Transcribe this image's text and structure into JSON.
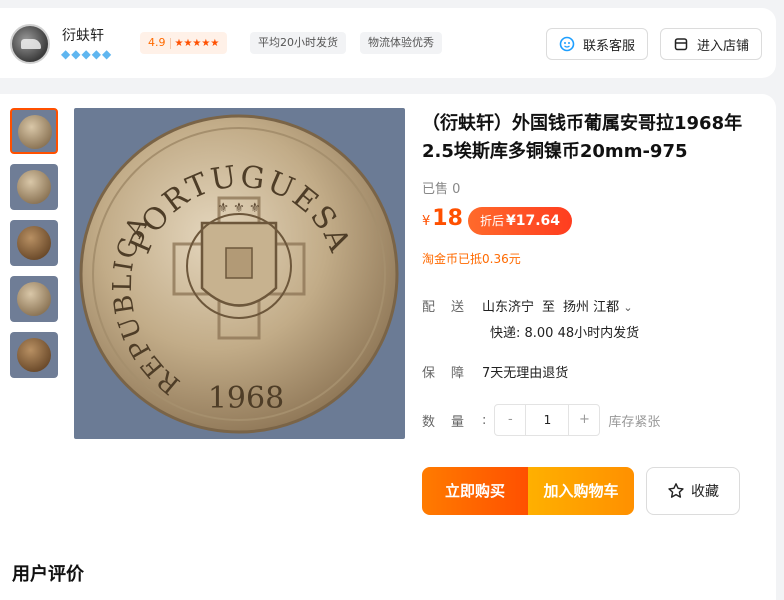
{
  "shop": {
    "name": "衍蚨轩",
    "rating": "4.9",
    "rating_stars": "★★★★★",
    "tags": [
      "平均20小时发货",
      "物流体验优秀"
    ],
    "service_button": "联系客服",
    "store_button": "进入店铺",
    "diamonds": [
      "💎",
      "💎",
      "💎",
      "💎",
      "💎"
    ]
  },
  "product": {
    "title": "（衍蚨轩）外国钱币葡属安哥拉1968年2.5埃斯库多铜镍币20mm-975",
    "sold": "已售 0",
    "price_currency": "¥",
    "price": "18",
    "coupon_label": "折后",
    "coupon_price": "¥17.64",
    "taojin": "淘金币已抵0.36元",
    "coin_text_top": "PORTUGUESA",
    "coin_text_left": "REPUBLICA",
    "coin_year": "1968"
  },
  "delivery": {
    "label": "配送",
    "from": "山东济宁",
    "to_word": "至",
    "to": "扬州 江都",
    "shipping": "快递: 8.00  48小时内发货"
  },
  "guarantee": {
    "label": "保障",
    "text": "7天无理由退货"
  },
  "quantity": {
    "label": "数量",
    "minus": "-",
    "value": "1",
    "plus": "+",
    "stock": "库存紧张"
  },
  "actions": {
    "buy_now": "立即购买",
    "add_cart": "加入购物车",
    "favorite": "收藏"
  },
  "reviews_title": "用户评价",
  "colors": {
    "accent": "#ff5000",
    "buy_gradient": "#ff7b00",
    "cart_gradient": "#ffb000"
  }
}
